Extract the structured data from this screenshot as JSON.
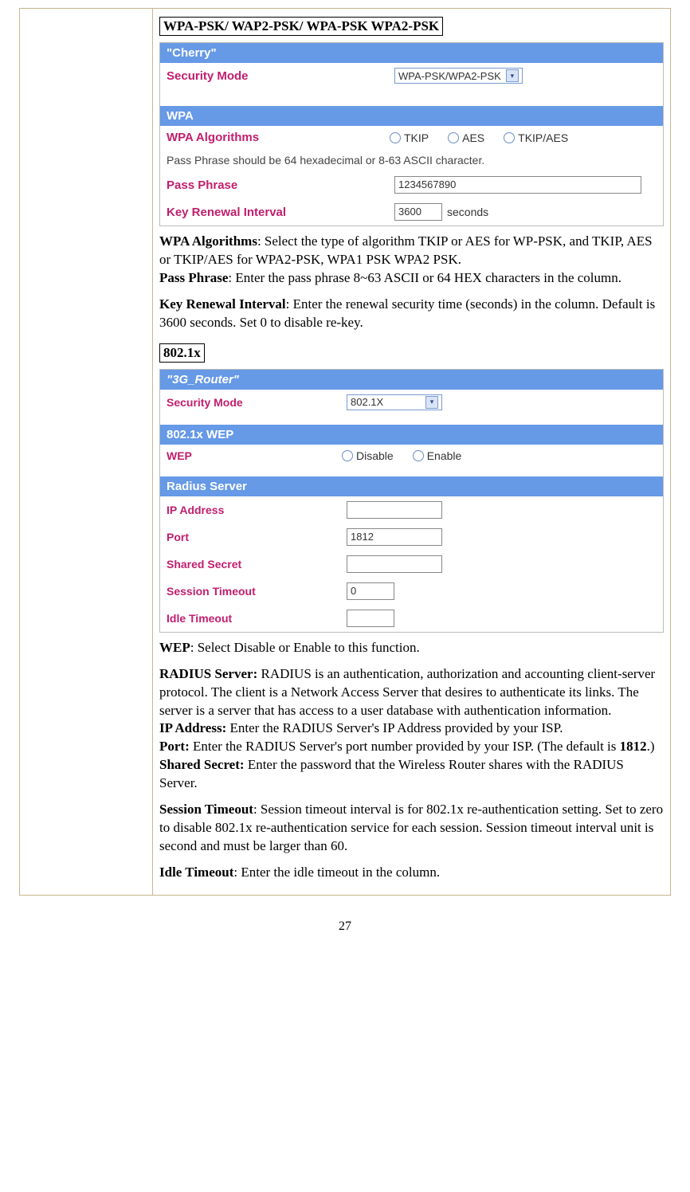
{
  "section1": {
    "heading": "WPA-PSK/ WAP2-PSK/ WPA-PSK WPA2-PSK",
    "shot": {
      "band_cherry": "\"Cherry\"",
      "securityMode_label": "Security Mode",
      "securityMode_value": "WPA-PSK/WPA2-PSK",
      "band_wpa": "WPA",
      "wpaAlg_label": "WPA Algorithms",
      "alg_tkip": "TKIP",
      "alg_aes": "AES",
      "alg_tkipaes": "TKIP/AES",
      "phrase_note": "Pass Phrase should be 64 hexadecimal or 8-63 ASCII character.",
      "pass_label": "Pass Phrase",
      "pass_value": "1234567890",
      "renewal_label": "Key Renewal Interval",
      "renewal_value": "3600",
      "seconds": "seconds"
    },
    "desc": {
      "alg_b": "WPA Algorithms",
      "alg_t": ": Select the type of algorithm TKIP or AES for WP-PSK, and TKIP, AES or TKIP/AES for WPA2-PSK, WPA1 PSK WPA2 PSK.",
      "pass_b": "Pass Phrase",
      "pass_t": ": Enter the pass phrase 8~63 ASCII or 64 HEX characters in the column.",
      "key_b": "Key Renewal Interval",
      "key_t": ": Enter the renewal security time (seconds) in the column. Default is 3600 seconds. Set 0 to disable re-key."
    }
  },
  "section2": {
    "heading": "802.1x",
    "shot": {
      "band_router": "\"3G_Router\"",
      "securityMode_label": "Security Mode",
      "securityMode_value": "802.1X",
      "band_wep": "802.1x WEP",
      "wep_label": "WEP",
      "wep_disable": "Disable",
      "wep_enable": "Enable",
      "band_radius": "Radius Server",
      "ip_label": "IP Address",
      "port_label": "Port",
      "port_value": "1812",
      "secret_label": "Shared Secret",
      "sess_label": "Session Timeout",
      "sess_value": "0",
      "idle_label": "Idle Timeout"
    },
    "desc": {
      "wep_b": "WEP",
      "wep_t": ": Select Disable or Enable to this function.",
      "radius_b": "RADIUS Server:",
      "radius_t": " RADIUS is an authentication, authorization and accounting client-server protocol. The client is a Network Access Server that desires to authenticate its links. The server is a server that has access to a user database with authentication information.",
      "ip_b": "IP Address:",
      "ip_t": " Enter the RADIUS Server's IP Address provided by your ISP.",
      "port_b": "Port:",
      "port_t1": " Enter the RADIUS Server's port number provided by your ISP. (The default is ",
      "port_v": "1812",
      "port_t2": ".)",
      "secret_b": "Shared Secret:",
      "secret_t": " Enter the password that the Wireless  Router shares with the RADIUS Server.",
      "sess_b": "Session Timeout",
      "sess_t": ": Session timeout interval is for 802.1x re-authentication setting. Set to zero to disable 802.1x re-authentication service for each session. Session timeout interval unit is second and must be larger than 60.",
      "idle_b": "Idle Timeout",
      "idle_t": ": Enter the idle timeout in the column."
    }
  },
  "pageNumber": "27"
}
